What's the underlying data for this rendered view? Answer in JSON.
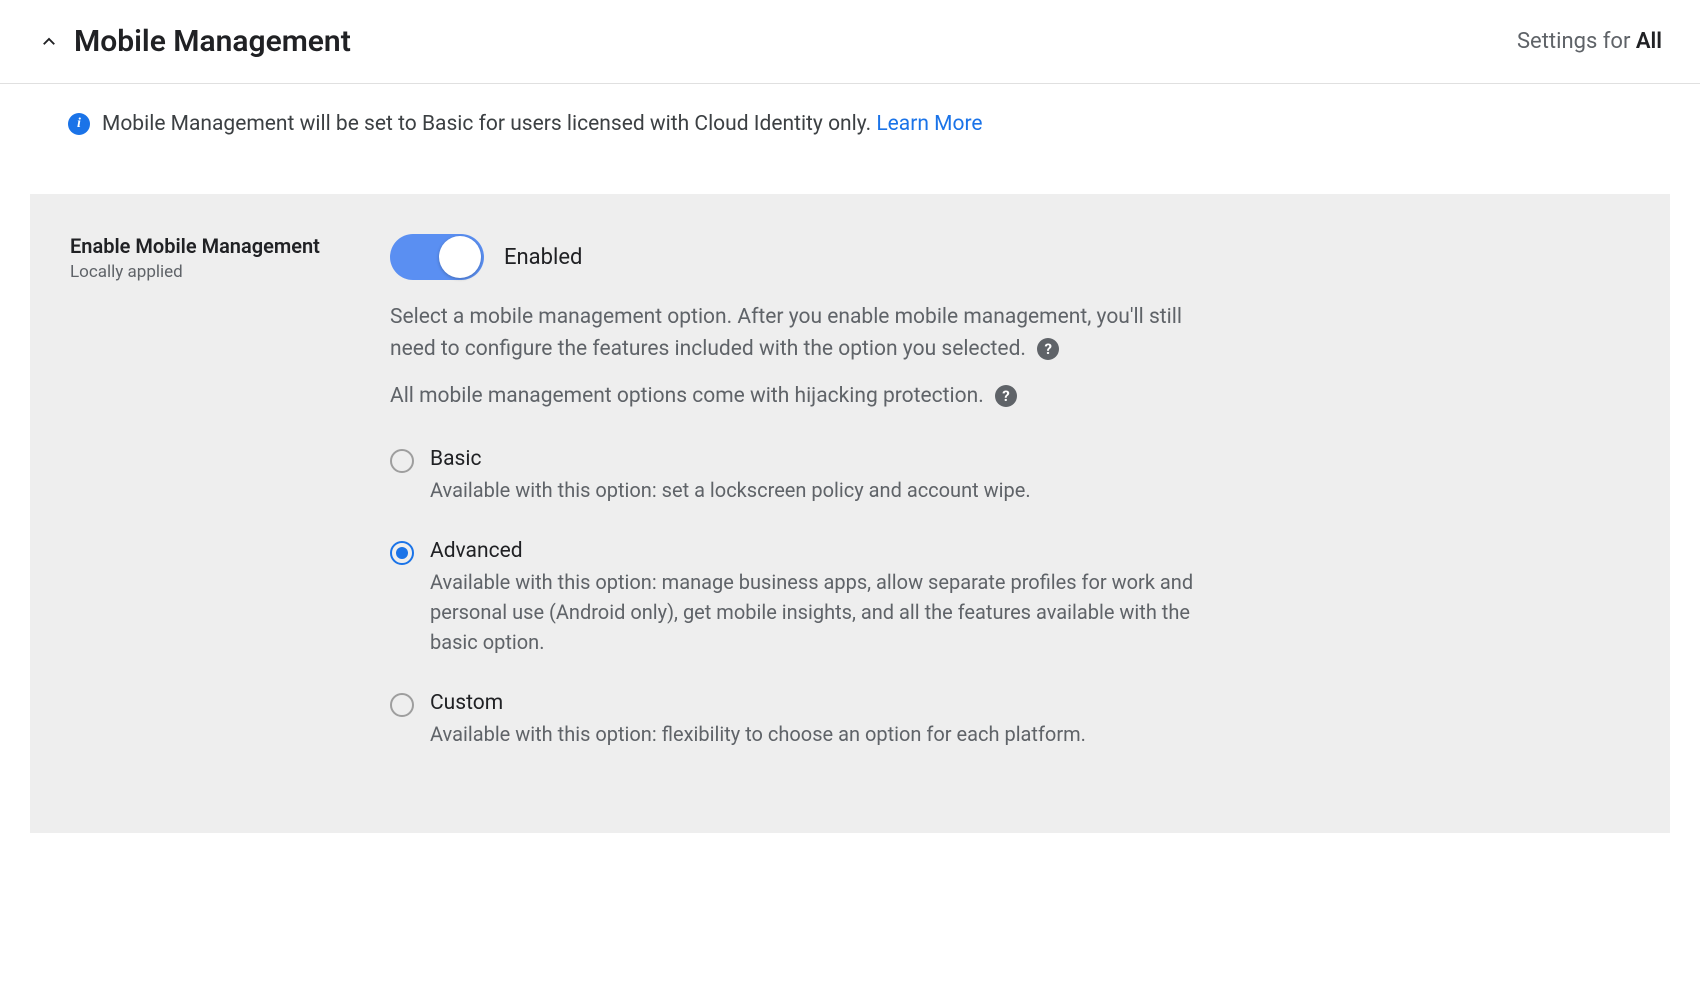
{
  "header": {
    "title": "Mobile Management",
    "settings_for_prefix": "Settings for ",
    "settings_for_value": "All"
  },
  "info_banner": {
    "text": "Mobile Management will be set to Basic for users licensed with Cloud Identity only. ",
    "link": "Learn More"
  },
  "setting": {
    "name": "Enable Mobile Management",
    "applied": "Locally applied",
    "toggle_label": "Enabled",
    "desc1": "Select a mobile management option. After you enable mobile management, you'll still need to configure the features included with the option you selected.",
    "desc2": "All mobile management options come with hijacking protection.",
    "options": [
      {
        "title": "Basic",
        "desc": "Available with this option: set a lockscreen policy and account wipe.",
        "selected": false
      },
      {
        "title": "Advanced",
        "desc": "Available with this option: manage business apps, allow separate profiles for work and personal use (Android only), get mobile insights, and all the features available with the basic option.",
        "selected": true
      },
      {
        "title": "Custom",
        "desc": "Available with this option: flexibility to choose an option for each platform.",
        "selected": false
      }
    ]
  }
}
